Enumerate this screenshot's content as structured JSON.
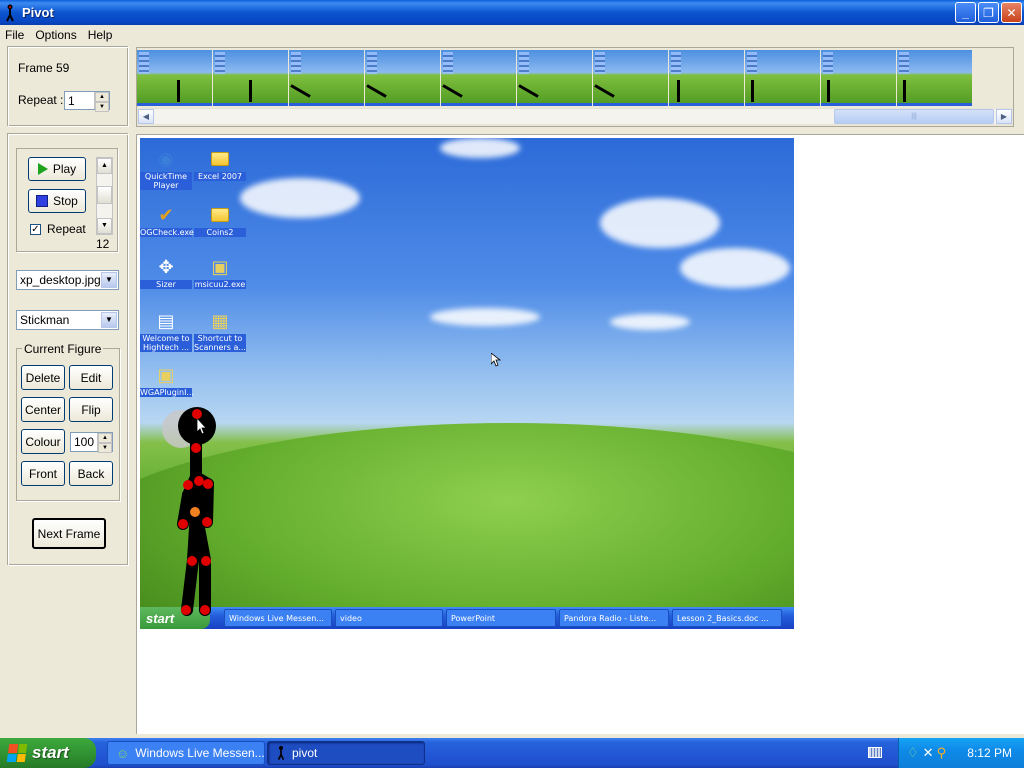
{
  "window": {
    "title": "Pivot",
    "controls": {
      "minimize": "_",
      "maximize": "❐",
      "close": "✕"
    }
  },
  "menu": [
    "File",
    "Options",
    "Help"
  ],
  "frame_panel": {
    "frame_label": "Frame 59",
    "repeat_label": "Repeat :",
    "repeat_value": "1"
  },
  "playback": {
    "play_label": "Play",
    "stop_label": "Stop",
    "repeat_label": "Repeat",
    "repeat_checked": "✓",
    "speed_value": "12"
  },
  "background_select": {
    "value": "xp_desktop.jpg"
  },
  "figure_type_select": {
    "value": "Stickman"
  },
  "current_figure": {
    "legend": "Current Figure",
    "delete_label": "Delete",
    "edit_label": "Edit",
    "center_label": "Center",
    "flip_label": "Flip",
    "colour_label": "Colour",
    "colour_value": "100",
    "front_label": "Front",
    "back_label": "Back"
  },
  "next_frame_label": "Next Frame",
  "thumbnail_count": 11,
  "desktop_icons": [
    {
      "label": "QuickTime Player"
    },
    {
      "label": "Excel 2007"
    },
    {
      "label": "OGCheck.exe"
    },
    {
      "label": "Coins2"
    },
    {
      "label": "Sizer"
    },
    {
      "label": "msicuu2.exe"
    },
    {
      "label": "Welcome to Hightech ..."
    },
    {
      "label": "Shortcut to Scanners a..."
    },
    {
      "label": "WGAPluginI..."
    }
  ],
  "inner_taskbar": {
    "start": "start",
    "items": [
      "Windows Live Messen...",
      "video",
      "PowerPoint",
      "Pandora Radio - Liste...",
      "Lesson 2_Basics.doc ..."
    ]
  },
  "taskbar": {
    "start": "start",
    "items": [
      {
        "label": "Windows Live Messen..."
      },
      {
        "label": "pivot"
      }
    ],
    "clock": "8:12 PM"
  },
  "colors": {
    "xp_blue": "#0b55d0",
    "start_green": "#2f8f2f",
    "joint_red": "#e00000",
    "joint_orange": "#f08020"
  }
}
